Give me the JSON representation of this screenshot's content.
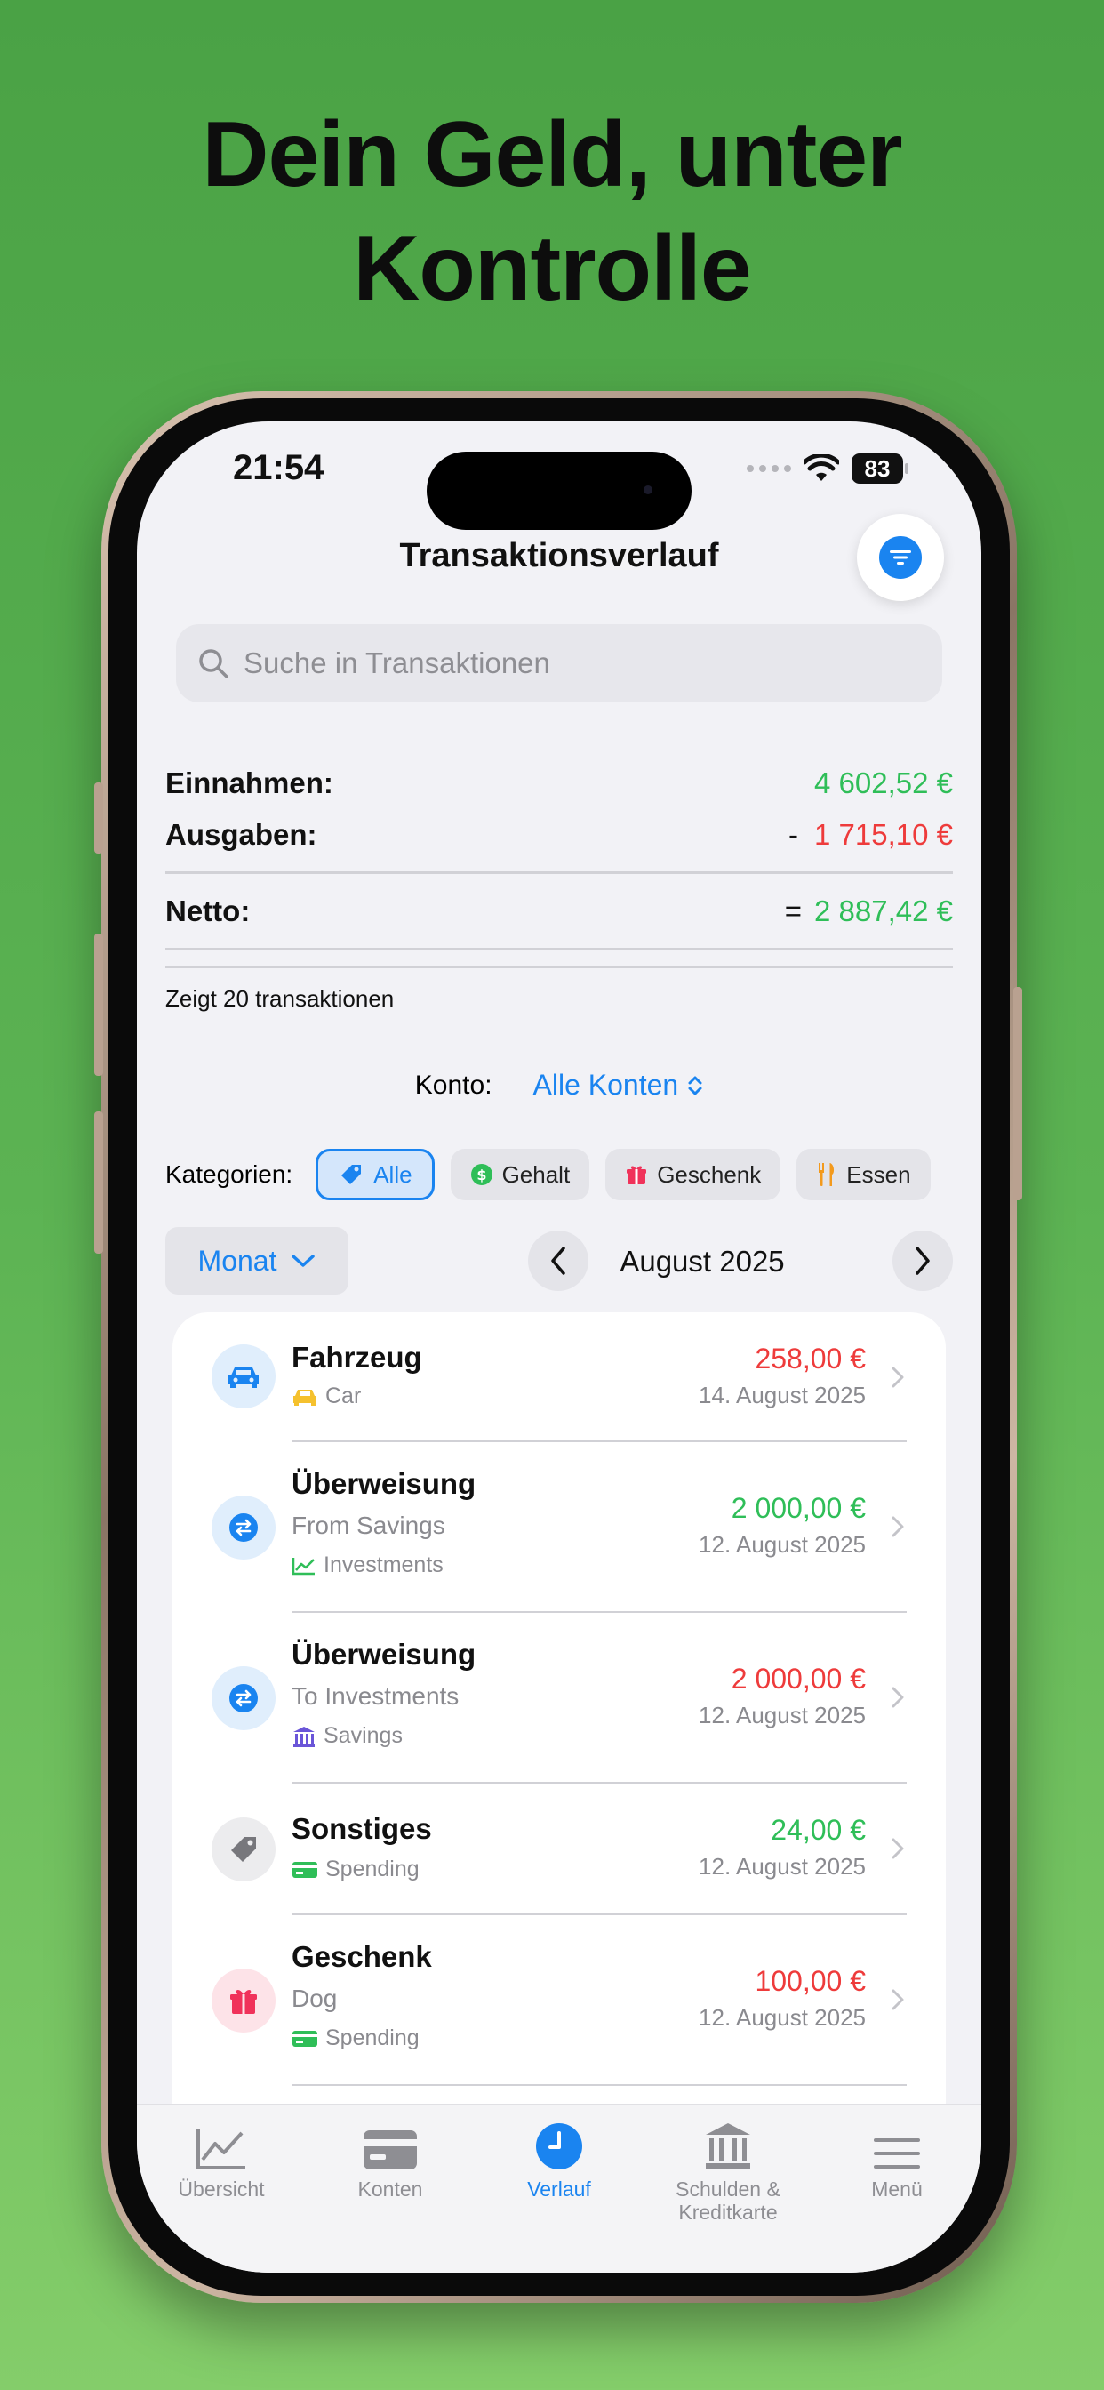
{
  "headline": [
    "Dein Geld, unter",
    "Kontrolle"
  ],
  "status": {
    "time": "21:54",
    "battery": "83"
  },
  "nav": {
    "title": "Transaktionsverlauf"
  },
  "search": {
    "placeholder": "Suche in Transaktionen"
  },
  "summary": {
    "income_label": "Einnahmen:",
    "income_value": "4 602,52 €",
    "expense_label": "Ausgaben:",
    "expense_sign": "-",
    "expense_value": "1 715,10 €",
    "net_label": "Netto:",
    "net_sign": "=",
    "net_value": "2 887,42 €",
    "count_text": "Zeigt 20 transaktionen"
  },
  "account": {
    "label": "Konto:",
    "value": "Alle Konten"
  },
  "categories": {
    "label": "Kategorien:",
    "chips": [
      {
        "label": "Alle",
        "icon": "tag-icon",
        "active": true
      },
      {
        "label": "Gehalt",
        "icon": "dollar-icon",
        "active": false
      },
      {
        "label": "Geschenk",
        "icon": "gift-icon",
        "active": false
      },
      {
        "label": "Essen",
        "icon": "fork-knife-icon",
        "active": false
      }
    ]
  },
  "period": {
    "mode": "Monat",
    "label": "August 2025"
  },
  "transactions": [
    {
      "title": "Fahrzeug",
      "account": "Car",
      "amount": "258,00 €",
      "date": "14. August 2025",
      "type": "expense"
    },
    {
      "title": "Überweisung",
      "subtitle": "From Savings",
      "account": "Investments",
      "amount": "2 000,00 €",
      "date": "12. August 2025",
      "type": "income"
    },
    {
      "title": "Überweisung",
      "subtitle": "To Investments",
      "account": "Savings",
      "amount": "2 000,00 €",
      "date": "12. August 2025",
      "type": "expense"
    },
    {
      "title": "Sonstiges",
      "account": "Spending",
      "amount": "24,00 €",
      "date": "12. August 2025",
      "type": "income"
    },
    {
      "title": "Geschenk",
      "subtitle": "Dog",
      "account": "Spending",
      "amount": "100,00 €",
      "date": "12. August 2025",
      "type": "expense"
    }
  ],
  "tabs": [
    {
      "label": "Übersicht",
      "icon": "chart-icon"
    },
    {
      "label": "Konten",
      "icon": "card-icon"
    },
    {
      "label": "Verlauf",
      "icon": "clock-icon",
      "active": true
    },
    {
      "label": "Schulden & Kreditkarte",
      "icon": "bank-icon"
    },
    {
      "label": "Menü",
      "icon": "menu-icon"
    }
  ],
  "colors": {
    "accent": "#1a84f0",
    "income": "#2fbe58",
    "expense": "#ee3b3b",
    "background": "#5cb353"
  }
}
